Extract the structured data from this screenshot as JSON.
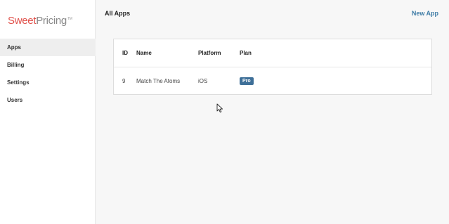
{
  "logo": {
    "sweet": "Sweet",
    "pricing": "Pricing",
    "mark": "TM"
  },
  "sidebar": {
    "items": [
      {
        "label": "Apps",
        "active": true
      },
      {
        "label": "Billing"
      },
      {
        "label": "Settings"
      },
      {
        "label": "Users"
      }
    ]
  },
  "main": {
    "title": "All Apps",
    "new_app_label": "New App"
  },
  "table": {
    "headers": [
      "ID",
      "Name",
      "Platform",
      "Plan"
    ],
    "rows": [
      {
        "id": "9",
        "name": "Match The Atoms",
        "platform": "iOS",
        "plan": "Pro"
      }
    ]
  },
  "colors": {
    "brand_red": "#e04f49",
    "link_blue": "#3e7ca6",
    "badge_blue": "#3e6f98"
  }
}
